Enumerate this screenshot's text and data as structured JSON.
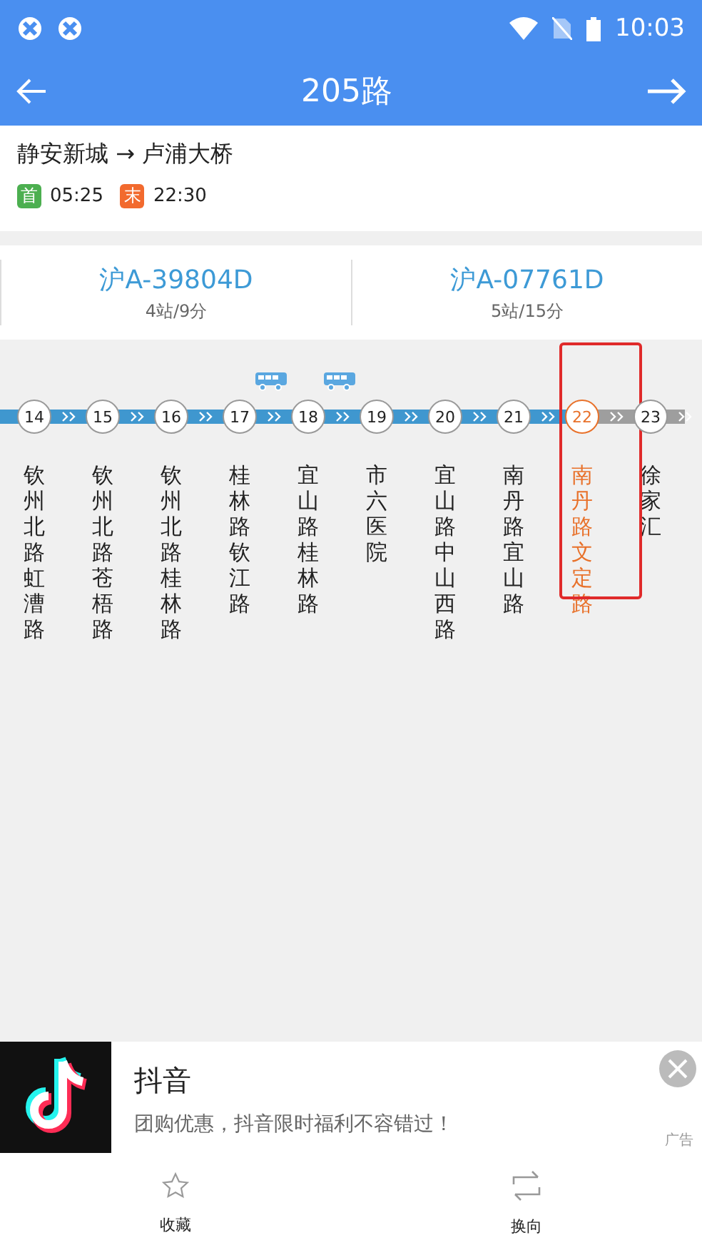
{
  "status_bar": {
    "time": "10:03"
  },
  "header": {
    "title": "205路"
  },
  "route": {
    "direction": "静安新城 → 卢浦大桥",
    "first_label": "首",
    "first_time": "05:25",
    "last_label": "末",
    "last_time": "22:30"
  },
  "buses": [
    {
      "plate": "沪A-39804D",
      "eta": "4站/9分"
    },
    {
      "plate": "沪A-07761D",
      "eta": "5站/15分"
    }
  ],
  "stations": [
    {
      "number": "14",
      "name": "钦州北路虹漕路",
      "reached": true,
      "bus_after": false,
      "selected": false
    },
    {
      "number": "15",
      "name": "钦州北路苍梧路",
      "reached": true,
      "bus_after": false,
      "selected": false
    },
    {
      "number": "16",
      "name": "钦州北路桂林路",
      "reached": true,
      "bus_after": false,
      "selected": false
    },
    {
      "number": "17",
      "name": "桂林路钦江路",
      "reached": true,
      "bus_after": true,
      "selected": false
    },
    {
      "number": "18",
      "name": "宜山路桂林路",
      "reached": true,
      "bus_after": true,
      "selected": false
    },
    {
      "number": "19",
      "name": "市六医院",
      "reached": true,
      "bus_after": false,
      "selected": false
    },
    {
      "number": "20",
      "name": "宜山路中山西路",
      "reached": true,
      "bus_after": false,
      "selected": false
    },
    {
      "number": "21",
      "name": "南丹路宜山路",
      "reached": true,
      "bus_after": false,
      "selected": false
    },
    {
      "number": "22",
      "name": "南丹路文定路",
      "reached": true,
      "bus_after": false,
      "selected": true
    },
    {
      "number": "23",
      "name": "徐家汇",
      "reached": false,
      "bus_after": false,
      "selected": false
    }
  ],
  "ad": {
    "title": "抖音",
    "text": "团购优惠，抖音限时福利不容错过！",
    "label": "广告"
  },
  "bottom_bar": [
    {
      "label": "收藏",
      "kind": "star"
    },
    {
      "label": "换向",
      "kind": "swap"
    }
  ]
}
